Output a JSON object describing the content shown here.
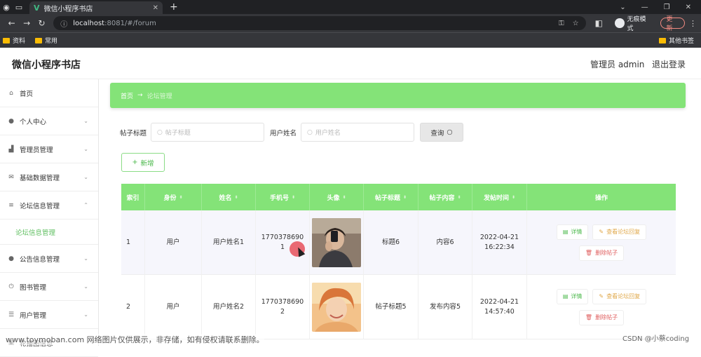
{
  "browser": {
    "tab_title": "微信小程序书店",
    "url_host": "localhost",
    "url_path": ":8081/#/forum",
    "incognito_label": "无痕模式",
    "update_label": "更新",
    "bookmarks": [
      "资料",
      "常用"
    ],
    "other_bookmarks": "其他书签"
  },
  "header": {
    "app_title": "微信小程序书店",
    "admin_label": "管理员 admin",
    "logout": "退出登录"
  },
  "sidebar": {
    "items": [
      {
        "label": "首页",
        "icon": "home-icon"
      },
      {
        "label": "个人中心",
        "icon": "user-icon"
      },
      {
        "label": "管理员管理",
        "icon": "chart-icon"
      },
      {
        "label": "基础数据管理",
        "icon": "mail-icon"
      },
      {
        "label": "论坛信息管理",
        "icon": "list-icon"
      },
      {
        "label": "论坛信息管理"
      },
      {
        "label": "公告信息管理",
        "icon": "user-icon"
      },
      {
        "label": "图书管理",
        "icon": "power-icon"
      },
      {
        "label": "用户管理",
        "icon": "sliders-icon"
      },
      {
        "label": "轮播图信息",
        "icon": "image-icon"
      }
    ]
  },
  "breadcrumb": {
    "home": "首页",
    "current": "论坛管理"
  },
  "search": {
    "title_label": "帖子标题",
    "title_placeholder": "帖子标题",
    "name_label": "用户姓名",
    "name_placeholder": "用户姓名",
    "query_button": "查询"
  },
  "add_button": "新增",
  "table": {
    "headers": [
      "索引",
      "身份",
      "姓名",
      "手机号",
      "头像",
      "帖子标题",
      "帖子内容",
      "发帖时间",
      "操作"
    ],
    "rows": [
      {
        "index": "1",
        "role": "用户",
        "name": "用户姓名1",
        "phone": "17703786901",
        "title": "标题6",
        "content": "内容6",
        "date": "2022-04-21",
        "time": "16:22:34"
      },
      {
        "index": "2",
        "role": "用户",
        "name": "用户姓名2",
        "phone": "17703786902",
        "title": "帖子标题5",
        "content": "发布内容5",
        "date": "2022-04-21",
        "time": "14:57:40"
      }
    ],
    "ops": {
      "detail": "详情",
      "reply": "查看论坛回复",
      "delete": "删除帖子"
    }
  },
  "watermark": "www.toymoban.com 网络图片仅供展示，非存储，如有侵权请联系删除。",
  "credit": "CSDN @小蔡coding"
}
